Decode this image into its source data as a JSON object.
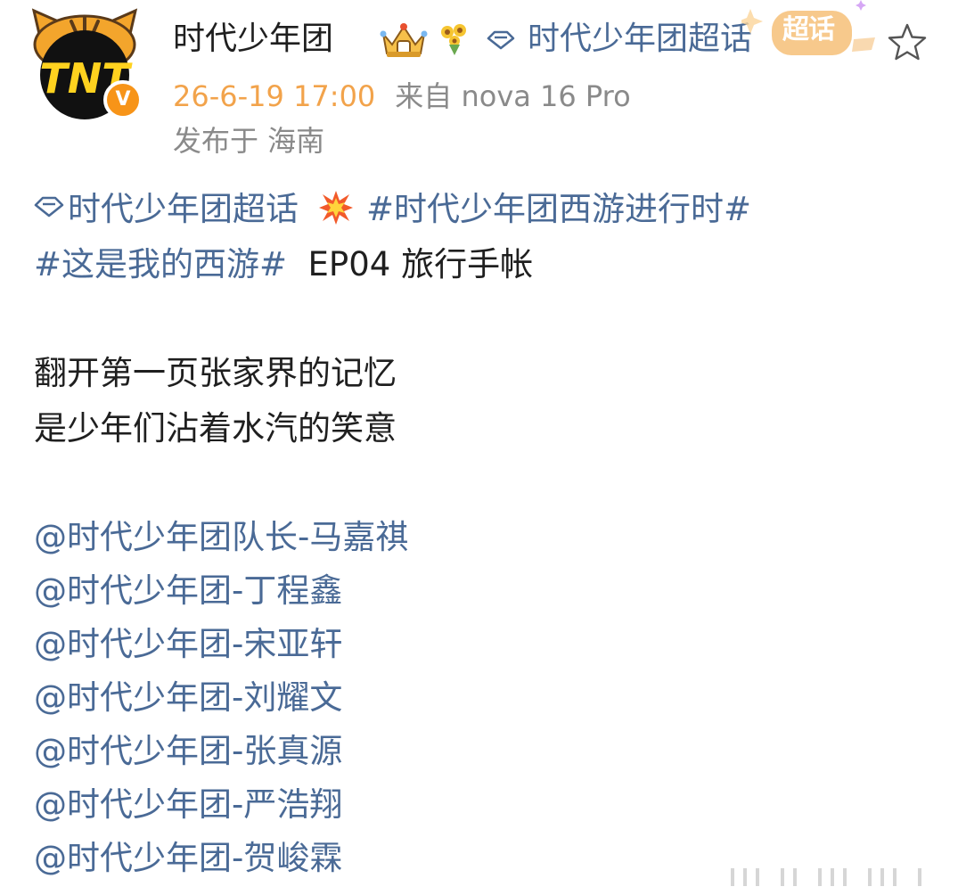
{
  "header": {
    "author_name": "时代少年团",
    "topic_link": "时代少年团超话",
    "supertopic_badge": "超话",
    "post_time": "26-6-19 17:00",
    "post_source": "来自 nova 16 Pro",
    "location": "发布于 海南",
    "verified_mark": "V"
  },
  "post": {
    "topic_super": "时代少年团超话",
    "hashtag_1": "#时代少年团西游进行时#",
    "hashtag_2": "#这是我的西游#",
    "title_text": "EP04 旅行手帐",
    "lines": [
      "翻开第一页张家界的记忆",
      "是少年们沾着水汽的笑意"
    ],
    "mentions": [
      "@时代少年团队长-马嘉祺",
      "@时代少年团-丁程鑫",
      "@时代少年团-宋亚轩",
      "@时代少年团-刘耀文",
      "@时代少年团-张真源",
      "@时代少年团-严浩翔",
      "@时代少年团-贺峻霖"
    ]
  },
  "colors": {
    "link": "#4a6a96",
    "time": "#f2a34b",
    "meta": "#8a8a8a",
    "badge": "#f79418"
  }
}
